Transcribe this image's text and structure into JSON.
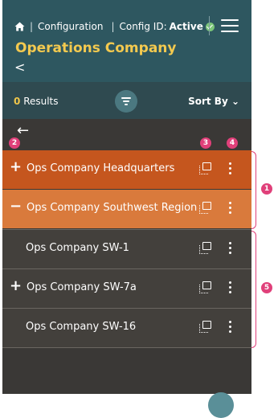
{
  "header": {
    "home_icon": "home-icon",
    "breadcrumb": "Configuration",
    "config_label": "Config ID:",
    "config_status": "Active",
    "menu_icon": "hamburger-icon",
    "title": "Operations Company",
    "back_symbol": "<"
  },
  "toolbar": {
    "results_count": "0",
    "results_label": "Results",
    "filter_icon": "filter-icon",
    "sort_label": "Sort By ⌄"
  },
  "nav": {
    "back_arrow": "←"
  },
  "rows": [
    {
      "sign": "+",
      "label": "Ops Company Headquarters",
      "level": "parent",
      "state": "collapsed"
    },
    {
      "sign": "−",
      "label": "Ops Company Southwest Region",
      "level": "parent",
      "state": "expanded"
    },
    {
      "sign": "",
      "label": "Ops Company SW-1",
      "level": "child"
    },
    {
      "sign": "+",
      "label": "Ops Company SW-7a",
      "level": "child",
      "state": "collapsed"
    },
    {
      "sign": "",
      "label": "Ops Company SW-16",
      "level": "child"
    }
  ],
  "callouts": [
    "1",
    "2",
    "3",
    "4",
    "5"
  ],
  "colors": {
    "header_bg": "#2e5760",
    "title": "#f3c94f",
    "row_headquarters": "#c5561e",
    "row_southwest": "#d97a3c",
    "row_child": "#43403c",
    "callout": "#e0407a",
    "status_ok": "#7cc67a"
  }
}
